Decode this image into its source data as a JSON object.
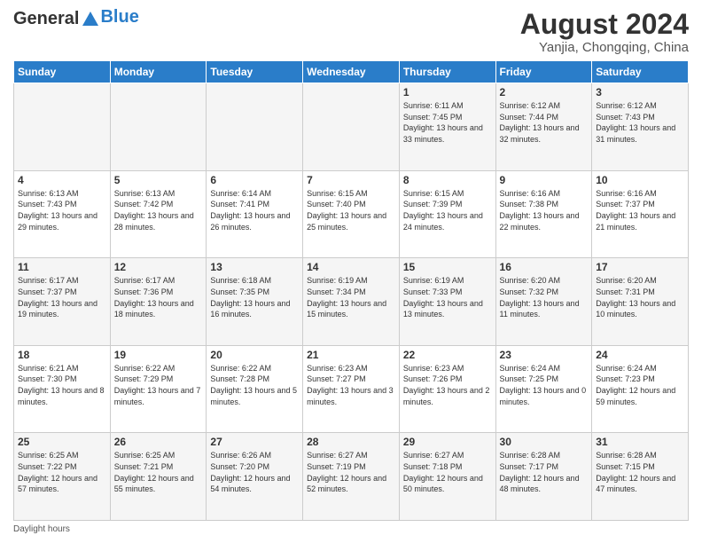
{
  "header": {
    "logo_general": "General",
    "logo_blue": "Blue",
    "month_year": "August 2024",
    "location": "Yanjia, Chongqing, China"
  },
  "days_of_week": [
    "Sunday",
    "Monday",
    "Tuesday",
    "Wednesday",
    "Thursday",
    "Friday",
    "Saturday"
  ],
  "weeks": [
    [
      {
        "day": "",
        "sunrise": "",
        "sunset": "",
        "daylight": ""
      },
      {
        "day": "",
        "sunrise": "",
        "sunset": "",
        "daylight": ""
      },
      {
        "day": "",
        "sunrise": "",
        "sunset": "",
        "daylight": ""
      },
      {
        "day": "",
        "sunrise": "",
        "sunset": "",
        "daylight": ""
      },
      {
        "day": "1",
        "sunrise": "Sunrise: 6:11 AM",
        "sunset": "Sunset: 7:45 PM",
        "daylight": "Daylight: 13 hours and 33 minutes."
      },
      {
        "day": "2",
        "sunrise": "Sunrise: 6:12 AM",
        "sunset": "Sunset: 7:44 PM",
        "daylight": "Daylight: 13 hours and 32 minutes."
      },
      {
        "day": "3",
        "sunrise": "Sunrise: 6:12 AM",
        "sunset": "Sunset: 7:43 PM",
        "daylight": "Daylight: 13 hours and 31 minutes."
      }
    ],
    [
      {
        "day": "4",
        "sunrise": "Sunrise: 6:13 AM",
        "sunset": "Sunset: 7:43 PM",
        "daylight": "Daylight: 13 hours and 29 minutes."
      },
      {
        "day": "5",
        "sunrise": "Sunrise: 6:13 AM",
        "sunset": "Sunset: 7:42 PM",
        "daylight": "Daylight: 13 hours and 28 minutes."
      },
      {
        "day": "6",
        "sunrise": "Sunrise: 6:14 AM",
        "sunset": "Sunset: 7:41 PM",
        "daylight": "Daylight: 13 hours and 26 minutes."
      },
      {
        "day": "7",
        "sunrise": "Sunrise: 6:15 AM",
        "sunset": "Sunset: 7:40 PM",
        "daylight": "Daylight: 13 hours and 25 minutes."
      },
      {
        "day": "8",
        "sunrise": "Sunrise: 6:15 AM",
        "sunset": "Sunset: 7:39 PM",
        "daylight": "Daylight: 13 hours and 24 minutes."
      },
      {
        "day": "9",
        "sunrise": "Sunrise: 6:16 AM",
        "sunset": "Sunset: 7:38 PM",
        "daylight": "Daylight: 13 hours and 22 minutes."
      },
      {
        "day": "10",
        "sunrise": "Sunrise: 6:16 AM",
        "sunset": "Sunset: 7:37 PM",
        "daylight": "Daylight: 13 hours and 21 minutes."
      }
    ],
    [
      {
        "day": "11",
        "sunrise": "Sunrise: 6:17 AM",
        "sunset": "Sunset: 7:37 PM",
        "daylight": "Daylight: 13 hours and 19 minutes."
      },
      {
        "day": "12",
        "sunrise": "Sunrise: 6:17 AM",
        "sunset": "Sunset: 7:36 PM",
        "daylight": "Daylight: 13 hours and 18 minutes."
      },
      {
        "day": "13",
        "sunrise": "Sunrise: 6:18 AM",
        "sunset": "Sunset: 7:35 PM",
        "daylight": "Daylight: 13 hours and 16 minutes."
      },
      {
        "day": "14",
        "sunrise": "Sunrise: 6:19 AM",
        "sunset": "Sunset: 7:34 PM",
        "daylight": "Daylight: 13 hours and 15 minutes."
      },
      {
        "day": "15",
        "sunrise": "Sunrise: 6:19 AM",
        "sunset": "Sunset: 7:33 PM",
        "daylight": "Daylight: 13 hours and 13 minutes."
      },
      {
        "day": "16",
        "sunrise": "Sunrise: 6:20 AM",
        "sunset": "Sunset: 7:32 PM",
        "daylight": "Daylight: 13 hours and 11 minutes."
      },
      {
        "day": "17",
        "sunrise": "Sunrise: 6:20 AM",
        "sunset": "Sunset: 7:31 PM",
        "daylight": "Daylight: 13 hours and 10 minutes."
      }
    ],
    [
      {
        "day": "18",
        "sunrise": "Sunrise: 6:21 AM",
        "sunset": "Sunset: 7:30 PM",
        "daylight": "Daylight: 13 hours and 8 minutes."
      },
      {
        "day": "19",
        "sunrise": "Sunrise: 6:22 AM",
        "sunset": "Sunset: 7:29 PM",
        "daylight": "Daylight: 13 hours and 7 minutes."
      },
      {
        "day": "20",
        "sunrise": "Sunrise: 6:22 AM",
        "sunset": "Sunset: 7:28 PM",
        "daylight": "Daylight: 13 hours and 5 minutes."
      },
      {
        "day": "21",
        "sunrise": "Sunrise: 6:23 AM",
        "sunset": "Sunset: 7:27 PM",
        "daylight": "Daylight: 13 hours and 3 minutes."
      },
      {
        "day": "22",
        "sunrise": "Sunrise: 6:23 AM",
        "sunset": "Sunset: 7:26 PM",
        "daylight": "Daylight: 13 hours and 2 minutes."
      },
      {
        "day": "23",
        "sunrise": "Sunrise: 6:24 AM",
        "sunset": "Sunset: 7:25 PM",
        "daylight": "Daylight: 13 hours and 0 minutes."
      },
      {
        "day": "24",
        "sunrise": "Sunrise: 6:24 AM",
        "sunset": "Sunset: 7:23 PM",
        "daylight": "Daylight: 12 hours and 59 minutes."
      }
    ],
    [
      {
        "day": "25",
        "sunrise": "Sunrise: 6:25 AM",
        "sunset": "Sunset: 7:22 PM",
        "daylight": "Daylight: 12 hours and 57 minutes."
      },
      {
        "day": "26",
        "sunrise": "Sunrise: 6:25 AM",
        "sunset": "Sunset: 7:21 PM",
        "daylight": "Daylight: 12 hours and 55 minutes."
      },
      {
        "day": "27",
        "sunrise": "Sunrise: 6:26 AM",
        "sunset": "Sunset: 7:20 PM",
        "daylight": "Daylight: 12 hours and 54 minutes."
      },
      {
        "day": "28",
        "sunrise": "Sunrise: 6:27 AM",
        "sunset": "Sunset: 7:19 PM",
        "daylight": "Daylight: 12 hours and 52 minutes."
      },
      {
        "day": "29",
        "sunrise": "Sunrise: 6:27 AM",
        "sunset": "Sunset: 7:18 PM",
        "daylight": "Daylight: 12 hours and 50 minutes."
      },
      {
        "day": "30",
        "sunrise": "Sunrise: 6:28 AM",
        "sunset": "Sunset: 7:17 PM",
        "daylight": "Daylight: 12 hours and 48 minutes."
      },
      {
        "day": "31",
        "sunrise": "Sunrise: 6:28 AM",
        "sunset": "Sunset: 7:15 PM",
        "daylight": "Daylight: 12 hours and 47 minutes."
      }
    ]
  ],
  "footer": {
    "daylight_label": "Daylight hours"
  }
}
